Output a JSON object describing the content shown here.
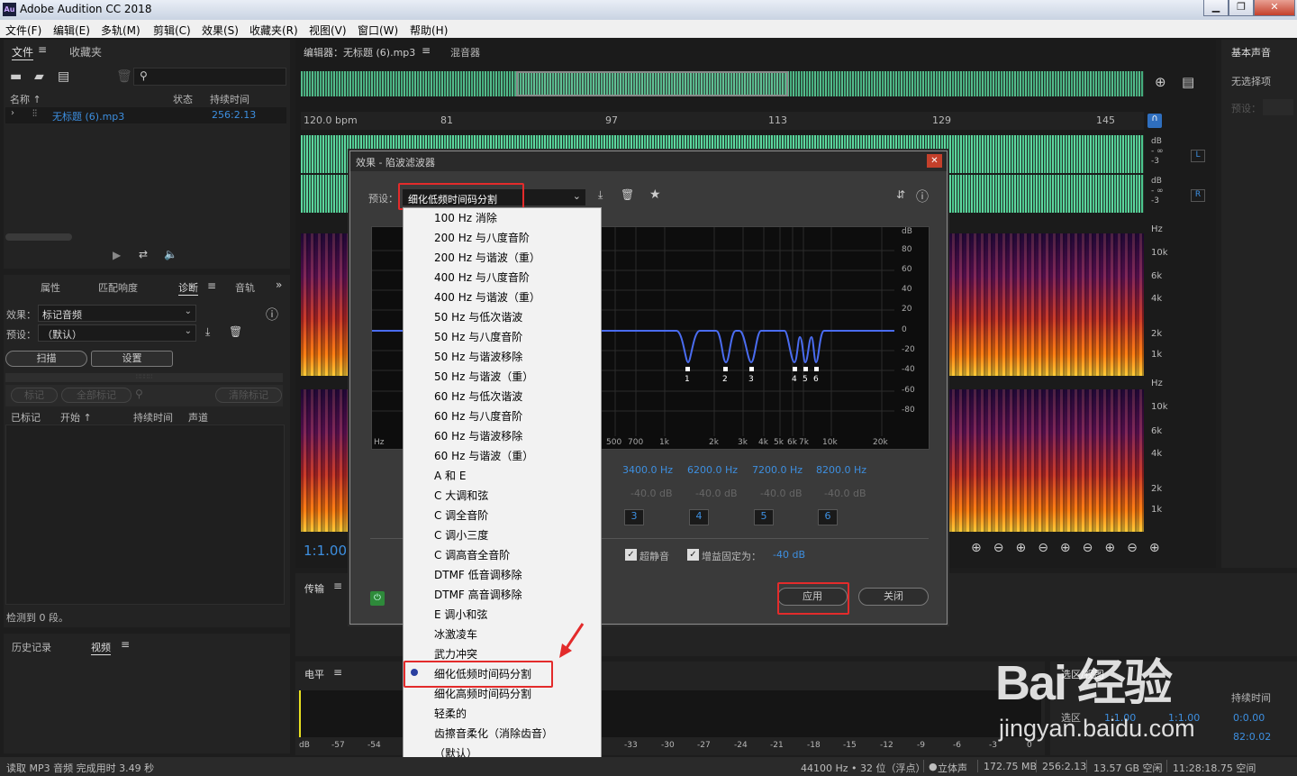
{
  "app": {
    "title": "Adobe Audition CC 2018",
    "icon": "Au"
  },
  "menu": [
    "文件(F)",
    "编辑(E)",
    "多轨(M)",
    "剪辑(C)",
    "效果(S)",
    "收藏夹(R)",
    "视图(V)",
    "窗口(W)",
    "帮助(H)"
  ],
  "files": {
    "tab1": "文件",
    "tab2": "收藏夹",
    "col_name": "名称 ↑",
    "col_status": "状态",
    "col_duration": "持续时间",
    "file_name": "无标题 (6).mp3",
    "file_duration": "256:2.13"
  },
  "diag": {
    "tabs": [
      "属性",
      "匹配响度",
      "诊断",
      "音轨"
    ],
    "effect_label": "效果：",
    "effect_value": "标记音频",
    "preset_label": "预设：",
    "preset_value": "（默认）",
    "scan": "扫描",
    "settings": "设置",
    "mark": "标记",
    "mark_all": "全部标记",
    "clear_marks": "清除标记",
    "col_marked": "已标记",
    "col_start": "开始 ↑",
    "col_dur": "持续时间",
    "col_channel": "声道",
    "detected": "检测到 0 段。"
  },
  "history": {
    "tab1": "历史记录",
    "tab2": "视频"
  },
  "editor": {
    "tab1": "编辑器：无标题 (6).mp3",
    "tab2": "混音器",
    "bpm": "120.0 bpm",
    "ruler": [
      "81",
      "97",
      "113",
      "129",
      "145"
    ],
    "time": "1:1.00",
    "db_labels": [
      "dB",
      "- ∞",
      "-3",
      "dB",
      "- ∞",
      "-3"
    ],
    "channels": [
      "L",
      "R"
    ],
    "hz_labels1": [
      "Hz",
      "10k",
      "6k",
      "4k",
      "2k",
      "1k"
    ],
    "hz_labels2": [
      "Hz",
      "10k",
      "6k",
      "4k",
      "2k",
      "1k"
    ]
  },
  "right": {
    "title": "基本声音",
    "noselect": "无选择项",
    "preset": "预设："
  },
  "transport": {
    "label": "传输"
  },
  "level": {
    "label": "电平",
    "scale": [
      "dB",
      "-57",
      "-54",
      "-33",
      "-30",
      "-27",
      "-24",
      "-21",
      "-18",
      "-15",
      "-12",
      "-9",
      "-6",
      "-3",
      "0"
    ]
  },
  "selview": {
    "label": "选区/视图",
    "col_dur": "持续时间",
    "row_sel": "选区",
    "sel_start": "1:1.00",
    "sel_end": "1:1.00",
    "sel_dur": "0:0.00",
    "view_dur": "82:0.02"
  },
  "dialog": {
    "title": "效果 - 陷波滤波器",
    "preset_label": "预设：",
    "preset_value": "细化低频时间码分割",
    "db_axis": [
      "dB",
      "80",
      "60",
      "40",
      "20",
      "0",
      "-20",
      "-40",
      "-60",
      "-80"
    ],
    "freq_axis": [
      "Hz",
      "500",
      "700",
      "1k",
      "2k",
      "3k",
      "4k",
      "5k",
      "6k",
      "7k",
      "10k",
      "20k"
    ],
    "notches": [
      "1",
      "2",
      "3",
      "4",
      "5",
      "6"
    ],
    "bands": [
      {
        "freq": "3400.0 Hz",
        "gain": "-40.0 dB",
        "num": "3"
      },
      {
        "freq": "6200.0 Hz",
        "gain": "-40.0 dB",
        "num": "4"
      },
      {
        "freq": "7200.0 Hz",
        "gain": "-40.0 dB",
        "num": "5"
      },
      {
        "freq": "8200.0 Hz",
        "gain": "-40.0 dB",
        "num": "6"
      }
    ],
    "ultra_quiet": "超静音",
    "fixed_gain": "增益固定为：",
    "fixed_gain_value": "-40 dB",
    "apply": "应用",
    "close": "关闭"
  },
  "dropdown": [
    "100 Hz 消除",
    "200 Hz 与八度音阶",
    "200 Hz 与谐波（重）",
    "400 Hz 与八度音阶",
    "400 Hz 与谐波（重）",
    "50 Hz 与低次谐波",
    "50 Hz 与八度音阶",
    "50 Hz 与谐波移除",
    "50 Hz 与谐波（重）",
    "60 Hz 与低次谐波",
    "60 Hz 与八度音阶",
    "60 Hz 与谐波移除",
    "60 Hz 与谐波（重）",
    "A 和 E",
    "C 大调和弦",
    "C 调全音阶",
    "C 调小三度",
    "C 调高音全音阶",
    "DTMF 低音调移除",
    "DTMF 高音调移除",
    "E 调小和弦",
    "冰激凌车",
    "武力冲突",
    "细化低频时间码分割",
    "细化高频时间码分割",
    "轻柔的",
    "齿擦音柔化（消除齿音）",
    "（默认）"
  ],
  "status": {
    "left": "读取 MP3 音频 完成用时 3.49 秒",
    "sr": "44100 Hz • 32 位（浮点）",
    "ch": "立体声",
    "size": "172.75 MB",
    "dur": "256:2.13",
    "free": "13.57 GB 空闲",
    "time": "11:28:18.75 空间"
  },
  "watermark": {
    "brand": "Bai 经验",
    "url": "jingyan.baidu.com"
  }
}
